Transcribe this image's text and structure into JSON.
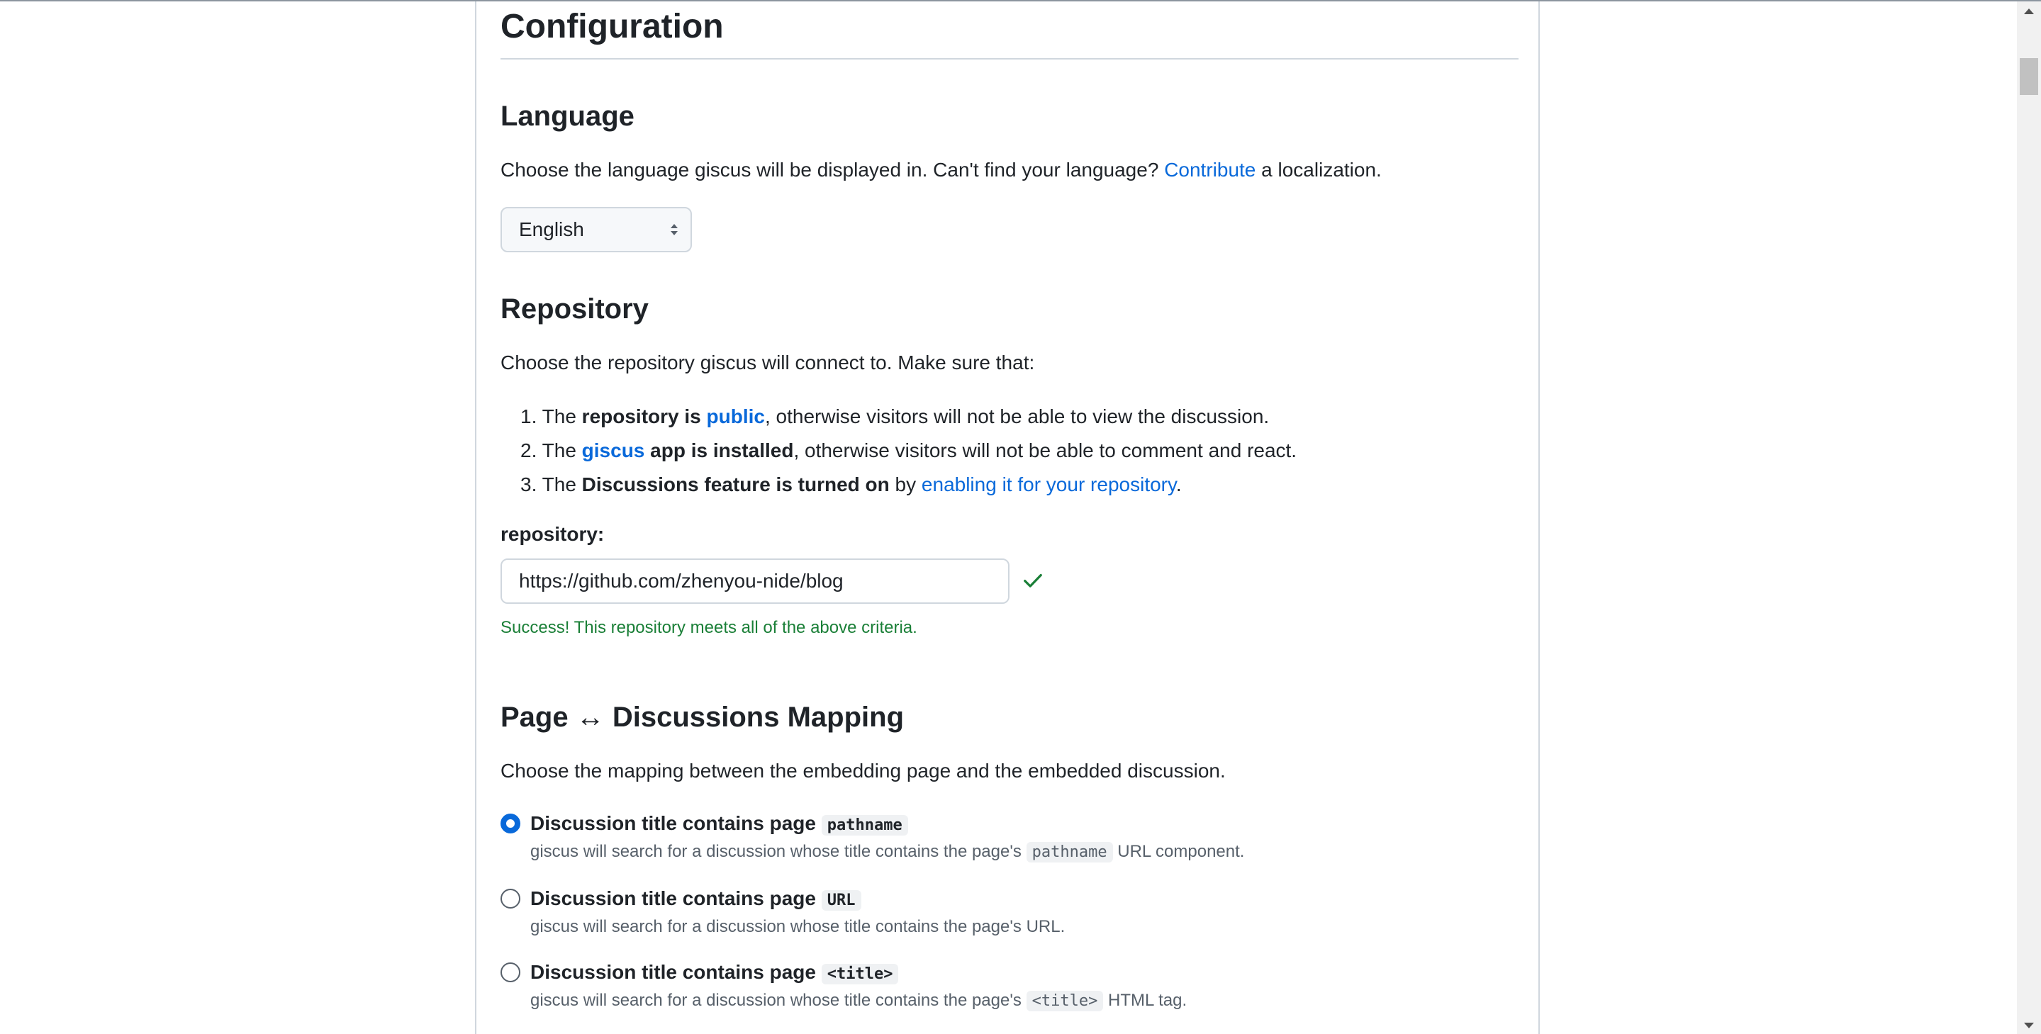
{
  "configuration": {
    "title": "Configuration"
  },
  "language": {
    "heading": "Language",
    "desc_before": "Choose the language giscus will be displayed in. Can't find your language? ",
    "desc_link": "Contribute",
    "desc_after": " a localization.",
    "selected": "English"
  },
  "repository": {
    "heading": "Repository",
    "desc": "Choose the repository giscus will connect to. Make sure that:",
    "criteria": [
      {
        "num": "1.",
        "pre": "The ",
        "bold": "repository is ",
        "link": "public",
        "post": ", otherwise visitors will not be able to view the discussion."
      },
      {
        "num": "2.",
        "pre": "The ",
        "link": "giscus",
        "bold": " app is installed",
        "post": ", otherwise visitors will not be able to comment and react."
      },
      {
        "num": "3.",
        "pre": "The ",
        "bold": "Discussions feature is turned on",
        "mid": " by ",
        "link": "enabling it for your repository",
        "post": "."
      }
    ],
    "field_label": "repository:",
    "field_value": "https://github.com/zhenyou-nide/blog",
    "success": "Success! This repository meets all of the above criteria.",
    "status_color": "#1a7f37"
  },
  "mapping": {
    "heading": "Page ↔ Discussions Mapping",
    "desc": "Choose the mapping between the embedding page and the embedded discussion.",
    "options": [
      {
        "title": "Discussion title contains page ",
        "code": "pathname",
        "desc_pre": "giscus will search for a discussion whose title contains the page's ",
        "desc_code": "pathname",
        "desc_post": " URL component.",
        "checked": true
      },
      {
        "title": "Discussion title contains page ",
        "code": "URL",
        "desc_pre": "giscus will search for a discussion whose title contains the page's URL.",
        "checked": false
      },
      {
        "title": "Discussion title contains page ",
        "code": "<title>",
        "desc_pre": "giscus will search for a discussion whose title contains the page's ",
        "desc_code": "<title>",
        "desc_post": " HTML tag.",
        "checked": false
      }
    ]
  },
  "colors": {
    "link": "#0969da",
    "radio_selected": "#0969da",
    "success": "#1a7f37"
  }
}
